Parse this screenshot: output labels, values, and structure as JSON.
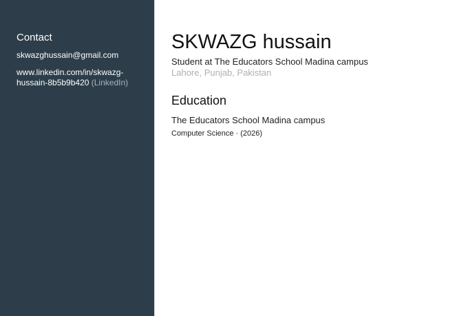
{
  "sidebar": {
    "contact_heading": "Contact",
    "email": "skwazghussain@gmail.com",
    "linkedin_url": "www.linkedin.com/in/skwazg-hussain-8b5b9b420",
    "linkedin_tag": "(LinkedIn)"
  },
  "profile": {
    "name": "SKWAZG hussain",
    "headline": "Student at The Educators School Madina campus",
    "location": "Lahore, Punjab, Pakistan"
  },
  "education": {
    "heading": "Education",
    "entries": [
      {
        "school": "The Educators School Madina campus",
        "detail": "Computer Science · (2026)"
      }
    ]
  },
  "colors": {
    "sidebar_bg": "#2d3e4a",
    "muted_text": "#b0b0b0",
    "linkedin_tag": "#a9b4bb"
  }
}
